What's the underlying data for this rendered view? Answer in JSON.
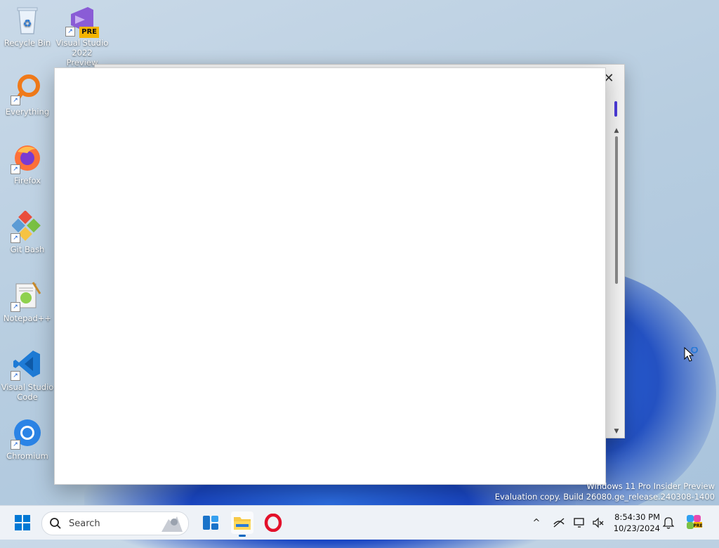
{
  "desktop": {
    "icons": [
      {
        "label": "Recycle Bin",
        "icon": "recycle-bin-icon"
      },
      {
        "label": "Visual Studio 2022 Preview",
        "icon": "visual-studio-icon",
        "badge": "PRE"
      },
      {
        "label": "Everything",
        "icon": "everything-search-icon"
      },
      {
        "label": "Firefox",
        "icon": "firefox-icon"
      },
      {
        "label": "Git Bash",
        "icon": "git-bash-icon"
      },
      {
        "label": "Notepad++",
        "icon": "notepad-plus-plus-icon"
      },
      {
        "label": "Visual Studio Code",
        "icon": "vscode-icon"
      },
      {
        "label": "Chromium",
        "icon": "chromium-icon"
      }
    ]
  },
  "back_window": {
    "close_symbol": "✕",
    "scroll_up": "▲",
    "scroll_down": "▼"
  },
  "watermark": {
    "line1": "Windows 11 Pro Insider Preview",
    "line2": "Evaluation copy. Build 26080.ge_release.240308-1400"
  },
  "taskbar": {
    "search_placeholder": "Search",
    "apps": [
      "start-icon",
      "widgets-icon",
      "file-explorer-icon",
      "opera-icon"
    ],
    "tray": {
      "chevron": "^",
      "time": "8:54:30 PM",
      "date": "10/23/2024"
    }
  },
  "colors": {
    "accent": "#0067c0",
    "scroll_accent": "#4b3bd9",
    "wallpaper_blue": "#1444bf"
  }
}
